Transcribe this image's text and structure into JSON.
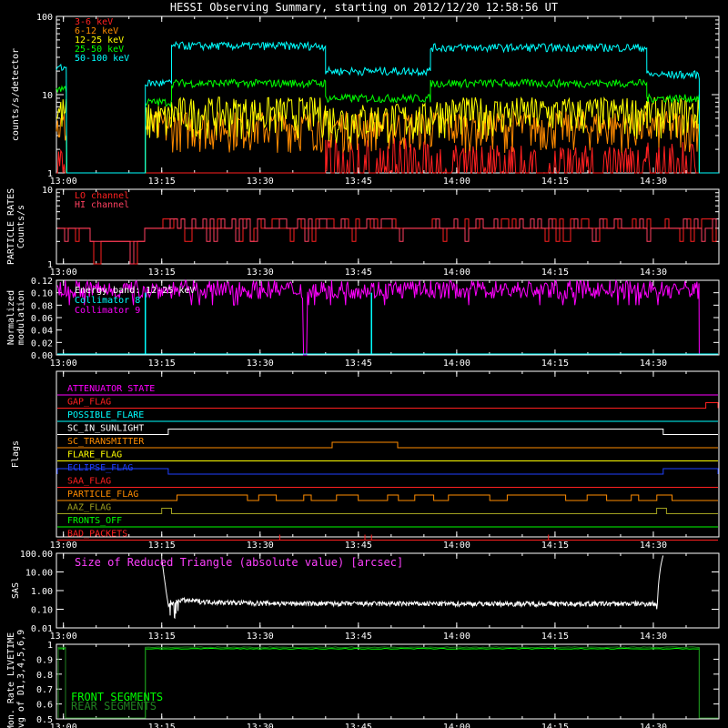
{
  "title": "HESSI Observing Summary, starting on 2012/12/20 12:58:56 UT",
  "time_ticks": [
    "13:00",
    "13:15",
    "13:30",
    "13:45",
    "14:00",
    "14:15",
    "14:30"
  ],
  "chart_data": [
    {
      "id": "count-rates",
      "type": "line",
      "ylabel": "counts/s/detector",
      "yscale": "log",
      "ylim": [
        1,
        100
      ],
      "xlim": [
        "12:58:56",
        "14:40:00"
      ],
      "ytick_labels": [
        "1",
        "10",
        "100"
      ],
      "legend_placement": "top-left",
      "series": [
        {
          "name": "3-6 keV",
          "color": "#ff2020"
        },
        {
          "name": "6-12 keV",
          "color": "#ff8c00"
        },
        {
          "name": "12-25 keV",
          "color": "#ffff00"
        },
        {
          "name": "25-50 keV",
          "color": "#00ff00"
        },
        {
          "name": "50-100 keV",
          "color": "#00ffff"
        }
      ],
      "segments": [
        {
          "from": "12:58:56",
          "to": "13:00:30",
          "levels": [
            1.5,
            4,
            6,
            12,
            22
          ]
        },
        {
          "from": "13:00:30",
          "to": "13:12:30",
          "levels": [
            1,
            1,
            1,
            1,
            1
          ]
        },
        {
          "from": "13:12:30",
          "to": "13:16:30",
          "levels": [
            1,
            4,
            5,
            8,
            14
          ]
        },
        {
          "from": "13:16:30",
          "to": "13:40:00",
          "levels": [
            1,
            4,
            6,
            14,
            42
          ]
        },
        {
          "from": "13:40:00",
          "to": "13:56:00",
          "levels": [
            1.8,
            4,
            5,
            9,
            20
          ]
        },
        {
          "from": "13:56:00",
          "to": "14:29:00",
          "levels": [
            1.5,
            4,
            6,
            14,
            40
          ]
        },
        {
          "from": "14:29:00",
          "to": "14:37:00",
          "levels": [
            1.6,
            4,
            6,
            9,
            18
          ]
        },
        {
          "from": "14:37:00",
          "to": "14:40:00",
          "levels": [
            1,
            1,
            1,
            1,
            1
          ]
        }
      ]
    },
    {
      "id": "particle-rates",
      "type": "line",
      "ylabel": "PARTICLE RATES Counts/s",
      "yscale": "log",
      "ylim": [
        1,
        10
      ],
      "ytick_labels": [
        "1",
        "10"
      ],
      "legend_placement": "top-left",
      "series": [
        {
          "name": "LO channel",
          "color": "#ff2020",
          "base": 3
        },
        {
          "name": "HI channel",
          "color": "#ff4060",
          "base": 3
        }
      ]
    },
    {
      "id": "modulation",
      "type": "line",
      "ylabel": "Normalized modulation",
      "ylim": [
        0,
        0.12
      ],
      "ytick_labels": [
        "0.00",
        "0.02",
        "0.04",
        "0.06",
        "0.08",
        "0.10",
        "0.12"
      ],
      "annotation": "Energy band: 12-25 keV",
      "legend_placement": "top-left",
      "series": [
        {
          "name": "Collimator 8",
          "color": "#00ffff"
        },
        {
          "name": "Collimator 9",
          "color": "#ff00ff",
          "level": 0.105
        }
      ]
    },
    {
      "id": "flags",
      "type": "line",
      "ylabel": "Flags",
      "series": [
        {
          "name": "ATTENUATOR STATE",
          "color": "#ff00ff",
          "steps": []
        },
        {
          "name": "GAP_FLAG",
          "color": "#ff2020",
          "steps": [
            [
              "14:38:00",
              "14:40:00"
            ]
          ]
        },
        {
          "name": "POSSIBLE_FLARE",
          "color": "#00ffff",
          "steps": []
        },
        {
          "name": "SC_IN_SUNLIGHT",
          "color": "#ffffff",
          "steps": [
            [
              "13:16:00",
              "14:31:30"
            ]
          ]
        },
        {
          "name": "SC_TRANSMITTER",
          "color": "#ff8c00",
          "steps": [
            [
              "13:41:00",
              "13:51:00"
            ]
          ]
        },
        {
          "name": "FLARE_FLAG",
          "color": "#ffff00",
          "steps": []
        },
        {
          "name": "ECLIPSE_FLAG",
          "color": "#2040ff",
          "steps": [
            [
              "12:58:56",
              "13:16:00"
            ],
            [
              "14:31:30",
              "14:40:00"
            ]
          ]
        },
        {
          "name": "SAA_FLAG",
          "color": "#ff2020",
          "steps": []
        },
        {
          "name": "PARTICLE_FLAG",
          "color": "#ff8c00",
          "steps": "intermittent"
        },
        {
          "name": "AAZ_FLAG",
          "color": "#a0a020",
          "steps": [
            [
              "13:15:00",
              "13:16:30"
            ],
            [
              "14:30:30",
              "14:32:00"
            ]
          ]
        },
        {
          "name": "FRONTS_OFF",
          "color": "#00ff00",
          "steps": []
        },
        {
          "name": "BAD_PACKETS",
          "color": "#ff2020",
          "steps": "spikes"
        }
      ]
    },
    {
      "id": "sas",
      "type": "line",
      "ylabel": "SAS",
      "yscale": "log",
      "ylim": [
        0.01,
        100
      ],
      "ytick_labels": [
        "0.01",
        "0.10",
        "1.00",
        "10.00",
        "100.00"
      ],
      "annotation": "Size of Reduced Triangle (absolute value) [arcsec]",
      "series": [
        {
          "name": "",
          "color": "#ffffff",
          "level": 0.2
        }
      ]
    },
    {
      "id": "livetime",
      "type": "line",
      "ylabel": "Mon. Rate LIVETIME avg of D1,3,4,5,6,9",
      "ylim": [
        0.5,
        1.0
      ],
      "ytick_labels": [
        "0.5",
        "0.6",
        "0.7",
        "0.8",
        "0.9",
        "1"
      ],
      "legend_placement": "bottom-left",
      "series": [
        {
          "name": "FRONT SEGMENTS",
          "color": "#00ff00",
          "level": 0.97
        },
        {
          "name": "REAR SEGMENTS",
          "color": "#208020",
          "level": 0.98
        }
      ]
    }
  ]
}
